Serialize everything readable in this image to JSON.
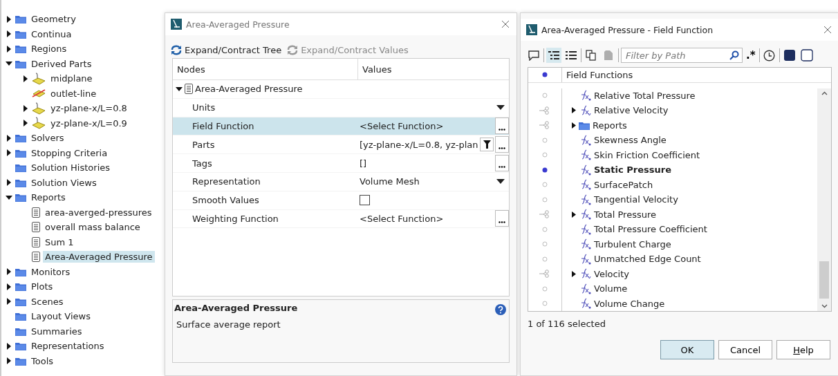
{
  "tree": [
    {
      "label": "Geometry",
      "kind": "folder",
      "expandable": true,
      "expanded": false,
      "selected": false
    },
    {
      "label": "Continua",
      "kind": "folder",
      "expandable": true,
      "expanded": false,
      "selected": false
    },
    {
      "label": "Regions",
      "kind": "folder",
      "expandable": true,
      "expanded": false,
      "selected": false
    },
    {
      "label": "Derived Parts",
      "kind": "folder",
      "expandable": true,
      "expanded": true,
      "selected": false,
      "children": [
        {
          "label": "midplane",
          "kind": "plane",
          "expandable": true,
          "expanded": false,
          "selected": false
        },
        {
          "label": "outlet-line",
          "kind": "line",
          "expandable": false,
          "expanded": false,
          "selected": false
        },
        {
          "label": "yz-plane-x/L=0.8",
          "kind": "plane",
          "expandable": true,
          "expanded": false,
          "selected": false
        },
        {
          "label": "yz-plane-x/L=0.9",
          "kind": "plane",
          "expandable": true,
          "expanded": false,
          "selected": false
        }
      ]
    },
    {
      "label": "Solvers",
      "kind": "folder",
      "expandable": true,
      "expanded": false,
      "selected": false
    },
    {
      "label": "Stopping Criteria",
      "kind": "folder",
      "expandable": true,
      "expanded": false,
      "selected": false
    },
    {
      "label": "Solution Histories",
      "kind": "folder",
      "expandable": false,
      "expanded": false,
      "selected": false
    },
    {
      "label": "Solution Views",
      "kind": "folder",
      "expandable": true,
      "expanded": false,
      "selected": false
    },
    {
      "label": "Reports",
      "kind": "folder",
      "expandable": true,
      "expanded": true,
      "selected": false,
      "children": [
        {
          "label": "area-averged-pressures",
          "kind": "report",
          "expandable": false,
          "expanded": false,
          "selected": false
        },
        {
          "label": "overall mass balance",
          "kind": "report",
          "expandable": false,
          "expanded": false,
          "selected": false
        },
        {
          "label": "Sum 1",
          "kind": "report",
          "expandable": false,
          "expanded": false,
          "selected": false
        },
        {
          "label": "Area-Averaged Pressure",
          "kind": "report",
          "expandable": false,
          "expanded": false,
          "selected": true
        }
      ]
    },
    {
      "label": "Monitors",
      "kind": "folder",
      "expandable": true,
      "expanded": false,
      "selected": false
    },
    {
      "label": "Plots",
      "kind": "folder",
      "expandable": true,
      "expanded": false,
      "selected": false
    },
    {
      "label": "Scenes",
      "kind": "folder",
      "expandable": true,
      "expanded": false,
      "selected": false
    },
    {
      "label": "Layout Views",
      "kind": "folder",
      "expandable": false,
      "expanded": false,
      "selected": false
    },
    {
      "label": "Summaries",
      "kind": "folder",
      "expandable": false,
      "expanded": false,
      "selected": false
    },
    {
      "label": "Representations",
      "kind": "folder",
      "expandable": true,
      "expanded": false,
      "selected": false
    },
    {
      "label": "Tools",
      "kind": "folder",
      "expandable": true,
      "expanded": false,
      "selected": false
    }
  ],
  "properties_dialog": {
    "title": "Area-Averaged Pressure",
    "toolbar": [
      {
        "label": "Expand/Contract Tree",
        "disabled": false
      },
      {
        "label": "Expand/Contract Values",
        "disabled": true
      }
    ],
    "columns": [
      "Nodes",
      "Values"
    ],
    "root": {
      "label": "Area-Averaged Pressure",
      "expanded": true
    },
    "rows": [
      {
        "label": "Units",
        "value": "",
        "kind": "dropdown",
        "selected": false
      },
      {
        "label": "Field Function",
        "value": "<Select Function>",
        "kind": "picker",
        "selected": true
      },
      {
        "label": "Parts",
        "value": "[yz-plane-x/L=0.8, yz-plan",
        "kind": "filter-picker",
        "selected": false
      },
      {
        "label": "Tags",
        "value": "[]",
        "kind": "picker",
        "selected": false
      },
      {
        "label": "Representation",
        "value": "Volume Mesh",
        "kind": "dropdown",
        "selected": false
      },
      {
        "label": "Smooth Values",
        "kind": "checkbox",
        "checked": false,
        "selected": false
      },
      {
        "label": "Weighting Function",
        "value": "<Select Function>",
        "kind": "picker",
        "selected": false
      }
    ],
    "description": {
      "title": "Area-Averaged Pressure",
      "text": "Surface average report"
    }
  },
  "field_function_dialog": {
    "title": "Area-Averaged Pressure - Field Function",
    "filter": {
      "placeholder": "Filter by Path"
    },
    "regex_button": ".*",
    "header": "Field Functions",
    "items": [
      {
        "label": "Relative Total Pressure",
        "kind": "scalar",
        "expandable": false,
        "selected": false
      },
      {
        "label": "Relative Velocity",
        "kind": "vector",
        "expandable": true,
        "selected": false
      },
      {
        "label": "Reports",
        "kind": "folder",
        "expandable": true,
        "selected": false
      },
      {
        "label": "Skewness Angle",
        "kind": "scalar",
        "expandable": false,
        "selected": false
      },
      {
        "label": "Skin Friction Coefficient",
        "kind": "scalar",
        "expandable": false,
        "selected": false
      },
      {
        "label": "Static Pressure",
        "kind": "scalar",
        "expandable": false,
        "selected": true
      },
      {
        "label": "SurfacePatch",
        "kind": "scalar",
        "expandable": false,
        "selected": false
      },
      {
        "label": "Tangential Velocity",
        "kind": "scalar",
        "expandable": false,
        "selected": false
      },
      {
        "label": "Total Pressure",
        "kind": "scalar",
        "expandable": true,
        "selected": false
      },
      {
        "label": "Total Pressure Coefficient",
        "kind": "scalar",
        "expandable": false,
        "selected": false
      },
      {
        "label": "Turbulent Charge",
        "kind": "scalar",
        "expandable": false,
        "selected": false
      },
      {
        "label": "Unmatched Edge Count",
        "kind": "scalar",
        "expandable": false,
        "selected": false
      },
      {
        "label": "Velocity",
        "kind": "vector",
        "expandable": true,
        "selected": false
      },
      {
        "label": "Volume",
        "kind": "scalar",
        "expandable": false,
        "selected": false
      },
      {
        "label": "Volume Change",
        "kind": "scalar",
        "expandable": false,
        "selected": false
      }
    ],
    "status": "1 of 116 selected",
    "buttons": [
      {
        "label": "OK",
        "default": true
      },
      {
        "label": "Cancel",
        "default": false
      },
      {
        "label": "Help",
        "default": false
      }
    ]
  }
}
